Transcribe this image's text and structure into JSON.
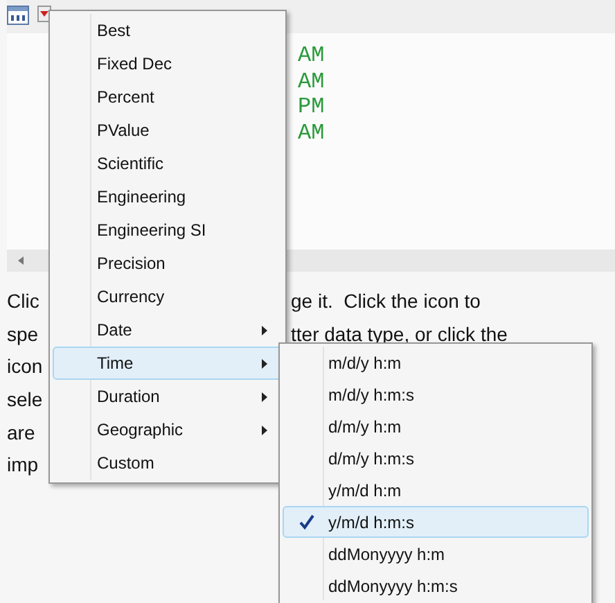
{
  "data_cells": [
    "AM",
    "AM",
    "PM",
    "AM"
  ],
  "description": [
    {
      "left": "Clic",
      "right": "ge it.  Click the icon to"
    },
    {
      "left": "spe",
      "right": "tter data type, or click the"
    },
    {
      "left": "icon"
    },
    {
      "left": "sele"
    },
    {
      "left": "are"
    },
    {
      "left": "imp"
    }
  ],
  "menu": {
    "items": [
      {
        "label": "Best",
        "submenu": false,
        "selected": false
      },
      {
        "label": "Fixed Dec",
        "submenu": false,
        "selected": false
      },
      {
        "label": "Percent",
        "submenu": false,
        "selected": false
      },
      {
        "label": "PValue",
        "submenu": false,
        "selected": false
      },
      {
        "label": "Scientific",
        "submenu": false,
        "selected": false
      },
      {
        "label": "Engineering",
        "submenu": false,
        "selected": false
      },
      {
        "label": "Engineering SI",
        "submenu": false,
        "selected": false
      },
      {
        "label": "Precision",
        "submenu": false,
        "selected": false
      },
      {
        "label": "Currency",
        "submenu": false,
        "selected": false
      },
      {
        "label": "Date",
        "submenu": true,
        "selected": false
      },
      {
        "label": "Time",
        "submenu": true,
        "selected": true
      },
      {
        "label": "Duration",
        "submenu": true,
        "selected": false
      },
      {
        "label": "Geographic",
        "submenu": true,
        "selected": false
      },
      {
        "label": "Custom",
        "submenu": false,
        "selected": false
      }
    ]
  },
  "submenu": {
    "items": [
      {
        "label": "m/d/y h:m",
        "checked": false,
        "selected": false
      },
      {
        "label": "m/d/y h:m:s",
        "checked": false,
        "selected": false
      },
      {
        "label": "d/m/y h:m",
        "checked": false,
        "selected": false
      },
      {
        "label": "d/m/y h:m:s",
        "checked": false,
        "selected": false
      },
      {
        "label": "y/m/d h:m",
        "checked": false,
        "selected": false
      },
      {
        "label": "y/m/d h:m:s",
        "checked": true,
        "selected": true
      },
      {
        "label": "ddMonyyyy h:m",
        "checked": false,
        "selected": false
      },
      {
        "label": "ddMonyyyy h:m:s",
        "checked": false,
        "selected": false
      }
    ]
  }
}
